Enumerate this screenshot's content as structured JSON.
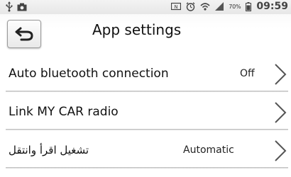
{
  "status_bar": {
    "left_icons": [
      "usb-icon",
      "photo-notification-icon"
    ],
    "right_icons": [
      "nfc-icon",
      "alarm-icon",
      "wifi-icon",
      "signal-icon",
      "battery-icon"
    ],
    "battery_percent": "70%",
    "time": "09:59"
  },
  "header": {
    "back_icon": "back-arrow-icon",
    "title": "App settings"
  },
  "settings": [
    {
      "label": "Auto bluetooth connection",
      "value": "Off",
      "icon": "chevron-right-icon"
    },
    {
      "label": "Link MY CAR radio",
      "value": "",
      "icon": "chevron-right-icon"
    },
    {
      "label": "تشغيل اقرأ وانتقل",
      "value": "Automatic",
      "icon": "chevron-right-icon"
    }
  ]
}
